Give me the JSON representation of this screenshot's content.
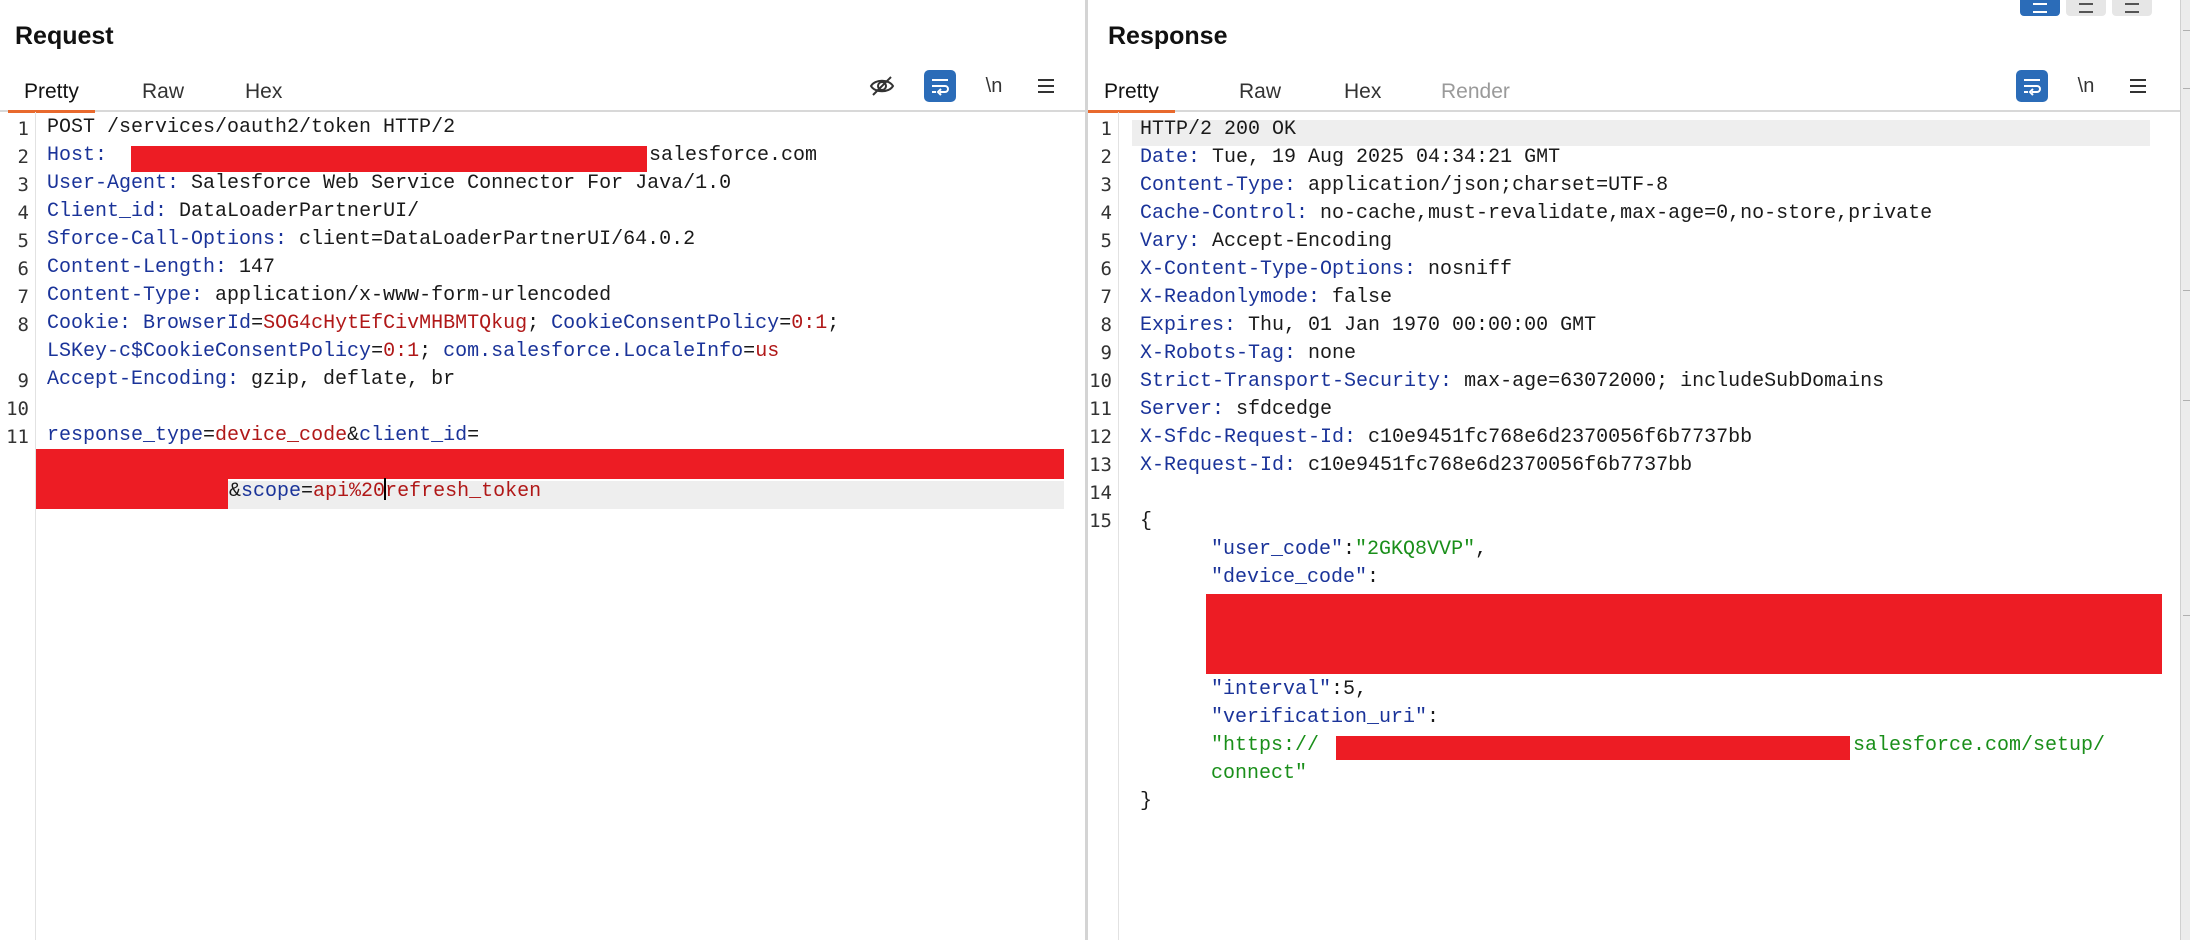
{
  "request": {
    "title": "Request",
    "tabs": [
      {
        "label": "Pretty",
        "active": true
      },
      {
        "label": "Raw",
        "active": false
      },
      {
        "label": "Hex",
        "active": false
      }
    ],
    "tools": {
      "hide_icon": "eye-off-icon",
      "wrap_icon": "wrap-icon",
      "newline_label": "\\n",
      "menu_icon": "hamburger-menu-icon"
    },
    "line_numbers": [
      "1",
      "2",
      "3",
      "4",
      "5",
      "6",
      "7",
      "8",
      "9",
      "10",
      "11"
    ],
    "lines": {
      "l1": "POST /services/oauth2/token HTTP/2",
      "l2_key": "Host:",
      "l2_val": "salesforce.com",
      "l3_key": "User-Agent:",
      "l3_val": " Salesforce Web Service Connector For Java/1.0",
      "l4_key": "Client_id:",
      "l4_val": " DataLoaderPartnerUI/",
      "l5_key": "Sforce-Call-Options:",
      "l5_val": " client=DataLoaderPartnerUI/64.0.2",
      "l6_key": "Content-Length:",
      "l6_val": " 147",
      "l7_key": "Content-Type:",
      "l7_val": " application/x-www-form-urlencoded",
      "l8_key": "Cookie:",
      "l8_c1_name": "BrowserId",
      "l8_c1_val": "SOG4cHytEfCivMHBMTQkug",
      "l8_c2_name": "CookieConsentPolicy",
      "l8_c2_val": "0:1",
      "l8b_c3_name": "LSKey-c$CookieConsentPolicy",
      "l8b_c3_val": "0:1",
      "l8b_c4_name": "com.salesforce.LocaleInfo",
      "l8b_c4_val": "us",
      "l9_key": "Accept-Encoding:",
      "l9_val": " gzip, deflate, br",
      "l11_p1_name": "response_type",
      "l11_p1_val": "device_code",
      "l11_p2_name": "client_id",
      "l11c_p3_name": "scope",
      "l11c_p3_val_a": "api%20",
      "l11c_p3_val_b": "refresh_token"
    }
  },
  "response": {
    "title": "Response",
    "tabs": [
      {
        "label": "Pretty",
        "active": true
      },
      {
        "label": "Raw",
        "active": false
      },
      {
        "label": "Hex",
        "active": false
      },
      {
        "label": "Render",
        "active": false
      }
    ],
    "tools": {
      "wrap_icon": "wrap-icon",
      "newline_label": "\\n",
      "menu_icon": "hamburger-menu-icon"
    },
    "line_numbers": [
      "1",
      "2",
      "3",
      "4",
      "5",
      "6",
      "7",
      "8",
      "9",
      "10",
      "11",
      "12",
      "13",
      "14",
      "15"
    ],
    "lines": {
      "l1": "HTTP/2 200 OK",
      "l2_key": "Date:",
      "l2_val": " Tue, 19 Aug 2025 04:34:21 GMT",
      "l3_key": "Content-Type:",
      "l3_val": " application/json;charset=UTF-8",
      "l4_key": "Cache-Control:",
      "l4_val": " no-cache,must-revalidate,max-age=0,no-store,private",
      "l5_key": "Vary:",
      "l5_val": " Accept-Encoding",
      "l6_key": "X-Content-Type-Options:",
      "l6_val": " nosniff",
      "l7_key": "X-Readonlymode:",
      "l7_val": " false",
      "l8_key": "Expires:",
      "l8_val": " Thu, 01 Jan 1970 00:00:00 GMT",
      "l9_key": "X-Robots-Tag:",
      "l9_val": " none",
      "l10_key": "Strict-Transport-Security:",
      "l10_val": " max-age=63072000; includeSubDomains",
      "l11_key": "Server:",
      "l11_val": " sfdcedge",
      "l12_key": "X-Sfdc-Request-Id:",
      "l12_val": " c10e9451fc768e6d2370056f6b7737bb",
      "l13_key": "X-Request-Id:",
      "l13_val": " c10e9451fc768e6d2370056f6b7737bb",
      "l15_open": "{",
      "j_user_code_key": "\"user_code\"",
      "j_user_code_val": "\"2GKQ8VVP\"",
      "j_device_code_key": "\"device_code\"",
      "j_interval_key": "\"interval\"",
      "j_interval_val": "5",
      "j_verif_key": "\"verification_uri\"",
      "j_verif_val_a": "\"https://",
      "j_verif_val_b": "salesforce.com/setup/",
      "j_verif_val_c": "connect\"",
      "close": "}"
    }
  },
  "view_toggle_icons": [
    "split-vertical-icon",
    "split-horizontal-icon",
    "single-pane-icon"
  ]
}
